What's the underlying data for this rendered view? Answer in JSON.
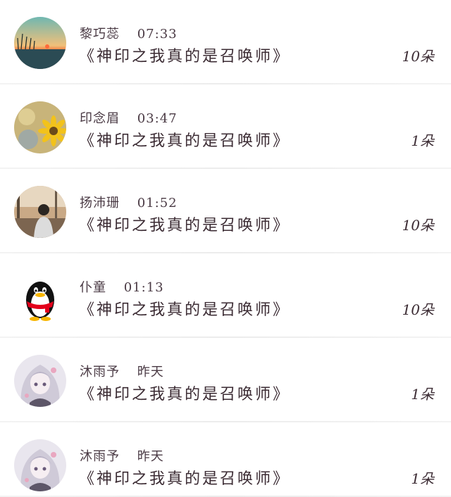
{
  "items": [
    {
      "name": "黎巧蕊",
      "time": "07:33",
      "title": "《神印之我真的是召唤师》",
      "count": "10朵",
      "avatar_icon": "sunset-icon"
    },
    {
      "name": "印念眉",
      "time": "03:47",
      "title": "《神印之我真的是召唤师》",
      "count": "1朵",
      "avatar_icon": "sunflower-icon"
    },
    {
      "name": "扬沛珊",
      "time": "01:52",
      "title": "《神印之我真的是召唤师》",
      "count": "10朵",
      "avatar_icon": "person-photo-icon"
    },
    {
      "name": "仆童",
      "time": "01:13",
      "title": "《神印之我真的是召唤师》",
      "count": "10朵",
      "avatar_icon": "penguin-icon"
    },
    {
      "name": "沐雨予",
      "time": "昨天",
      "title": "《神印之我真的是召唤师》",
      "count": "1朵",
      "avatar_icon": "anime-girl-icon"
    },
    {
      "name": "沐雨予",
      "time": "昨天",
      "title": "《神印之我真的是召唤师》",
      "count": "1朵",
      "avatar_icon": "anime-girl-icon"
    }
  ]
}
